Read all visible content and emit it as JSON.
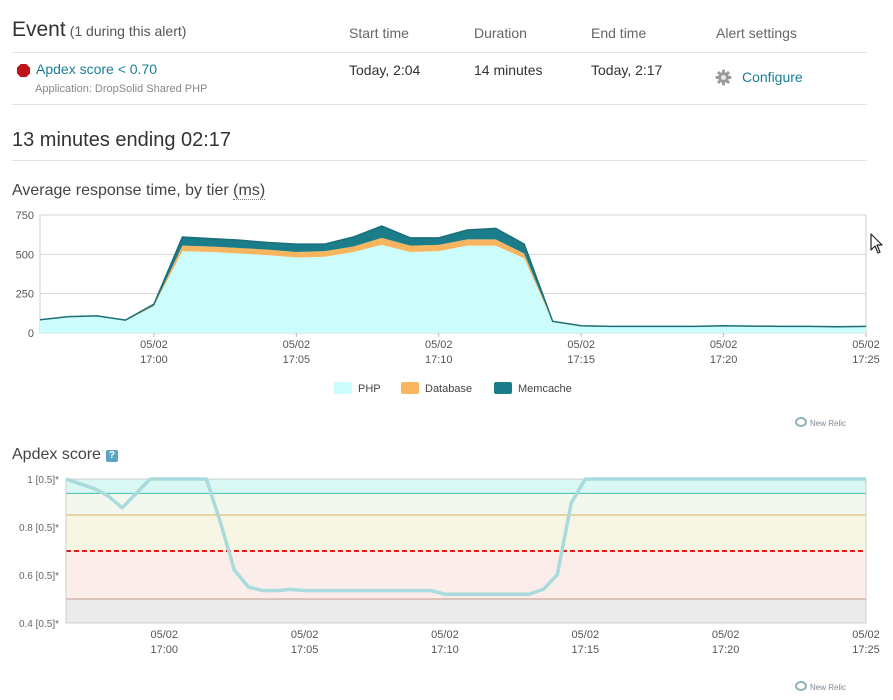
{
  "header": {
    "title": "Event",
    "subtitle": "(1 during this alert)",
    "columns": {
      "start": "Start time",
      "duration": "Duration",
      "end": "End time",
      "settings": "Alert settings"
    }
  },
  "event": {
    "name": "Apdex score < 0.70",
    "application": "Application: DropSolid Shared PHP",
    "start": "Today, 2:04",
    "duration": "14 minutes",
    "end": "Today, 2:17",
    "configure_label": "Configure",
    "status_icon": "stop-icon",
    "settings_icon": "gear-icon"
  },
  "section_title": "13 minutes ending 02:17",
  "response_chart": {
    "title_prefix": "Average response time, by tier ",
    "title_unit": "(ms)",
    "legend": [
      "PHP",
      "Database",
      "Memcache"
    ],
    "credit": "New Relic"
  },
  "apdex_chart": {
    "title": "Apdex score",
    "help": "?",
    "credit": "New Relic"
  },
  "colors": {
    "link": "#1a7e96",
    "php": "#ccfcfc",
    "database": "#f7b560",
    "memcache": "#1b7d8a",
    "apdex_line": "#a9dbdc",
    "threshold": "#d90000"
  },
  "chart_data": [
    {
      "type": "area",
      "title": "Average response time, by tier (ms)",
      "stacked": true,
      "x": [
        "16:56",
        "16:57",
        "16:58",
        "16:59",
        "17:00",
        "17:01",
        "17:02",
        "17:03",
        "17:04",
        "17:05",
        "17:06",
        "17:07",
        "17:08",
        "17:09",
        "17:10",
        "17:11",
        "17:12",
        "17:13",
        "17:14",
        "17:15",
        "17:16",
        "17:17",
        "17:18",
        "17:19",
        "17:20",
        "17:21",
        "17:22",
        "17:23",
        "17:24",
        "17:25"
      ],
      "x_tick_labels": [
        {
          "date": "05/02",
          "time": "17:00"
        },
        {
          "date": "05/02",
          "time": "17:05"
        },
        {
          "date": "05/02",
          "time": "17:10"
        },
        {
          "date": "05/02",
          "time": "17:15"
        },
        {
          "date": "05/02",
          "time": "17:20"
        },
        {
          "date": "05/02",
          "time": "17:25"
        }
      ],
      "series": [
        {
          "name": "PHP",
          "values": [
            80,
            100,
            105,
            78,
            170,
            520,
            515,
            505,
            495,
            480,
            485,
            515,
            560,
            515,
            520,
            555,
            555,
            475,
            70,
            42,
            38,
            38,
            38,
            38,
            42,
            40,
            38,
            38,
            36,
            38
          ]
        },
        {
          "name": "Database",
          "values": [
            2,
            2,
            2,
            2,
            5,
            35,
            35,
            35,
            35,
            35,
            35,
            35,
            45,
            40,
            40,
            40,
            40,
            30,
            2,
            2,
            2,
            2,
            2,
            2,
            2,
            2,
            2,
            2,
            2,
            2
          ]
        },
        {
          "name": "Memcache",
          "values": [
            2,
            2,
            2,
            2,
            8,
            55,
            50,
            50,
            45,
            50,
            45,
            60,
            75,
            50,
            45,
            60,
            70,
            60,
            2,
            2,
            2,
            2,
            2,
            2,
            2,
            2,
            2,
            2,
            2,
            2
          ]
        }
      ],
      "ylim": [
        0,
        750
      ],
      "y_ticks": [
        0,
        250,
        500,
        750
      ],
      "grid": true,
      "legend_position": "bottom"
    },
    {
      "type": "line",
      "title": "Apdex score",
      "x": [
        "16:56:30",
        "16:57",
        "16:57:30",
        "16:58",
        "16:58:30",
        "16:59",
        "16:59:30",
        "17:00",
        "17:00:30",
        "17:01",
        "17:01:30",
        "17:02",
        "17:02:30",
        "17:03",
        "17:03:30",
        "17:04",
        "17:04:30",
        "17:05",
        "17:05:30",
        "17:06",
        "17:06:30",
        "17:07",
        "17:07:30",
        "17:08",
        "17:08:30",
        "17:09",
        "17:09:30",
        "17:10",
        "17:10:30",
        "17:11",
        "17:11:30",
        "17:12",
        "17:12:30",
        "17:13",
        "17:13:30",
        "17:14",
        "17:14:30",
        "17:15",
        "17:15:30",
        "17:16",
        "17:17",
        "17:18",
        "17:19",
        "17:20",
        "17:21",
        "17:22",
        "17:23",
        "17:24",
        "17:25"
      ],
      "values": [
        1.0,
        0.98,
        0.96,
        0.93,
        0.88,
        0.94,
        1.0,
        1.0,
        1.0,
        1.0,
        1.0,
        0.82,
        0.62,
        0.55,
        0.535,
        0.535,
        0.54,
        0.535,
        0.535,
        0.535,
        0.535,
        0.535,
        0.535,
        0.535,
        0.535,
        0.535,
        0.535,
        0.52,
        0.52,
        0.52,
        0.52,
        0.52,
        0.52,
        0.52,
        0.54,
        0.6,
        0.9,
        1.0,
        1.0,
        1.0,
        1.0,
        1.0,
        1.0,
        1.0,
        1.0,
        1.0,
        1.0,
        1.0,
        1.0
      ],
      "x_tick_labels": [
        {
          "date": "05/02",
          "time": "17:00"
        },
        {
          "date": "05/02",
          "time": "17:05"
        },
        {
          "date": "05/02",
          "time": "17:10"
        },
        {
          "date": "05/02",
          "time": "17:15"
        },
        {
          "date": "05/02",
          "time": "17:20"
        },
        {
          "date": "05/02",
          "time": "17:25"
        }
      ],
      "y_tick_labels": [
        "1 [0.5]*",
        "0.8 [0.5]*",
        "0.6 [0.5]*",
        "0.4 [0.5]*"
      ],
      "y_ticks": [
        1.0,
        0.8,
        0.6,
        0.4
      ],
      "ylim": [
        0.4,
        1.0
      ],
      "bands": [
        {
          "from": 0.94,
          "to": 1.0,
          "color": "#d9f7f3",
          "line": "#3fc1b0"
        },
        {
          "from": 0.85,
          "to": 0.94,
          "color": "#f3f8ee",
          "line": "#d9b25a"
        },
        {
          "from": 0.7,
          "to": 0.85,
          "color": "#f7f5e3",
          "line": "#d90000"
        },
        {
          "from": 0.5,
          "to": 0.7,
          "color": "#fbeeea",
          "line": "#c69a8e"
        },
        {
          "from": 0.4,
          "to": 0.5,
          "color": "#ebebeb",
          "line": null
        }
      ],
      "threshold": 0.7
    }
  ]
}
